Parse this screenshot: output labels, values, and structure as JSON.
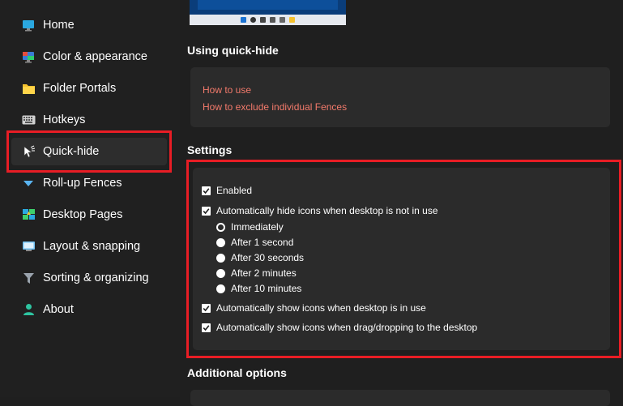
{
  "sidebar": {
    "items": [
      {
        "label": "Home",
        "icon": "monitor-icon"
      },
      {
        "label": "Color & appearance",
        "icon": "color-monitor-icon"
      },
      {
        "label": "Folder Portals",
        "icon": "folder-icon"
      },
      {
        "label": "Hotkeys",
        "icon": "keyboard-icon"
      },
      {
        "label": "Quick-hide",
        "icon": "quick-hide-icon",
        "selected": true
      },
      {
        "label": "Roll-up Fences",
        "icon": "roll-up-icon"
      },
      {
        "label": "Desktop Pages",
        "icon": "desktop-pages-icon"
      },
      {
        "label": "Layout & snapping",
        "icon": "layout-icon"
      },
      {
        "label": "Sorting & organizing",
        "icon": "funnel-icon"
      },
      {
        "label": "About",
        "icon": "person-icon"
      }
    ]
  },
  "main": {
    "quick_hide": {
      "title": "Using quick-hide",
      "links": [
        "How to use",
        "How to exclude individual Fences"
      ]
    },
    "settings": {
      "title": "Settings",
      "enabled": {
        "label": "Enabled",
        "checked": true
      },
      "auto_hide": {
        "label": "Automatically hide icons when desktop is not in use",
        "checked": true
      },
      "delay_options": [
        {
          "label": "Immediately",
          "selected": true
        },
        {
          "label": "After 1 second",
          "selected": false
        },
        {
          "label": "After 30 seconds",
          "selected": false
        },
        {
          "label": "After 2 minutes",
          "selected": false
        },
        {
          "label": "After 10 minutes",
          "selected": false
        }
      ],
      "auto_show": {
        "label": "Automatically show icons when desktop is in use",
        "checked": true
      },
      "show_on_drag": {
        "label": "Automatically show icons when drag/dropping to the desktop",
        "checked": true
      }
    },
    "additional": {
      "title": "Additional options"
    }
  },
  "colors": {
    "background": "#1f1f1f",
    "card": "#2b2b2b",
    "link": "#f37a6b",
    "highlight": "#e81d25"
  }
}
